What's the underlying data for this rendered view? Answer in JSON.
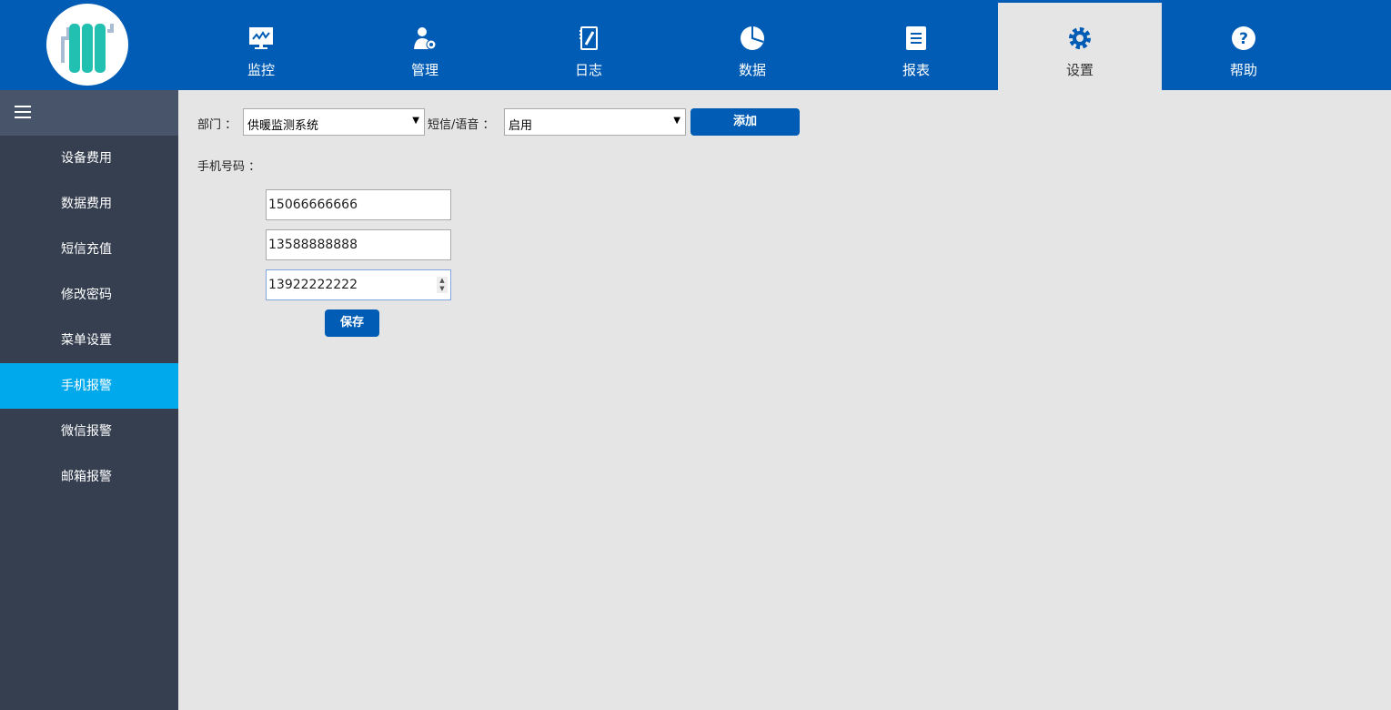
{
  "nav": [
    {
      "label": "监控",
      "icon": "monitor-chart-icon"
    },
    {
      "label": "管理",
      "icon": "user-gear-icon"
    },
    {
      "label": "日志",
      "icon": "notebook-pen-icon"
    },
    {
      "label": "数据",
      "icon": "pie-chart-icon"
    },
    {
      "label": "报表",
      "icon": "document-icon"
    },
    {
      "label": "设置",
      "icon": "gear-icon",
      "active": true
    },
    {
      "label": "帮助",
      "icon": "help-icon"
    }
  ],
  "sidebar": {
    "items": [
      "设备费用",
      "数据费用",
      "短信充值",
      "修改密码",
      "菜单设置",
      "手机报警",
      "微信报警",
      "邮箱报警"
    ],
    "active": "手机报警"
  },
  "form": {
    "dept_label": "部门 ：",
    "dept_value": "供暖监测系统",
    "sms_label": "短信/语音 ：",
    "sms_value": "启用",
    "add_label": "添加",
    "phone_label": "手机号码 ：",
    "phones": [
      "15066666666",
      "13588888888",
      "13922222222"
    ],
    "save_label": "保存"
  },
  "colors": {
    "brand": "#005cb4",
    "active_side": "#00a8ec",
    "sidebar": "#353f50"
  }
}
